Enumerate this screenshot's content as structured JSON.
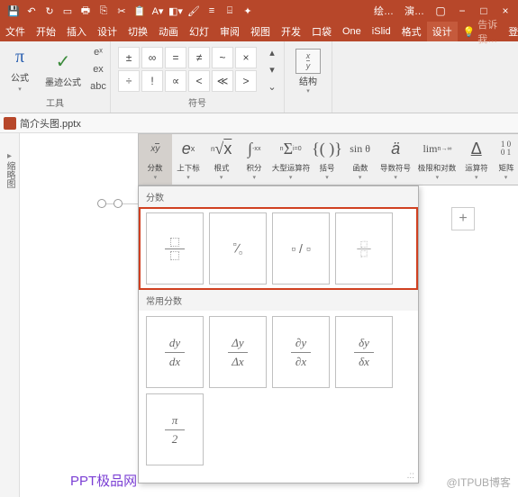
{
  "titlebar": {
    "context_tabs": [
      "绘…",
      "演…"
    ],
    "window_buttons": [
      "▢",
      "−",
      "□",
      "×"
    ]
  },
  "ribbon_tabs": [
    "文件",
    "开始",
    "插入",
    "设计",
    "切换",
    "动画",
    "幻灯",
    "审阅",
    "视图",
    "开发",
    "口袋",
    "One",
    "iSlid",
    "格式",
    "设计"
  ],
  "tellme": "告诉我…",
  "login": "登录",
  "tools_group": {
    "equation": "公式",
    "ink": "墨迹公式",
    "label": "工具"
  },
  "symbols": {
    "cells": [
      "±",
      "∞",
      "=",
      "≠",
      "~",
      "×",
      "÷",
      "!",
      "∝",
      "<",
      "≪",
      ">"
    ],
    "label": "符号"
  },
  "structures_group": {
    "label": "结构",
    "icon": "x/y"
  },
  "docbar": {
    "filename": "简介头图.pptx"
  },
  "sidebar": {
    "label": "缩略图"
  },
  "eq_toolbar": [
    {
      "icon": "x/y",
      "label": "分数"
    },
    {
      "icon": "eˣ",
      "label": "上下标"
    },
    {
      "icon": "ⁿ√x",
      "label": "根式"
    },
    {
      "icon": "∫",
      "label": "积分"
    },
    {
      "icon": "Σ",
      "label": "大型运算符"
    },
    {
      "icon": "{()}",
      "label": "括号"
    },
    {
      "icon": "sinθ",
      "label": "函数"
    },
    {
      "icon": "ä",
      "label": "导数符号"
    },
    {
      "icon": "lim",
      "label": "极限和对数"
    },
    {
      "icon": "Δ",
      "label": "运算符"
    },
    {
      "icon": "10\n01",
      "label": "矩阵"
    }
  ],
  "dropdown": {
    "section1": "分数",
    "templates": [
      "stacked",
      "skewed",
      "linear",
      "small"
    ],
    "section2": "常用分数",
    "common": [
      "dy/dx",
      "Δy/Δx",
      "∂y/∂x",
      "δy/δx",
      "π/2"
    ]
  },
  "watermark_left": "PPT极品网",
  "watermark_right": "@ITPUB博客"
}
